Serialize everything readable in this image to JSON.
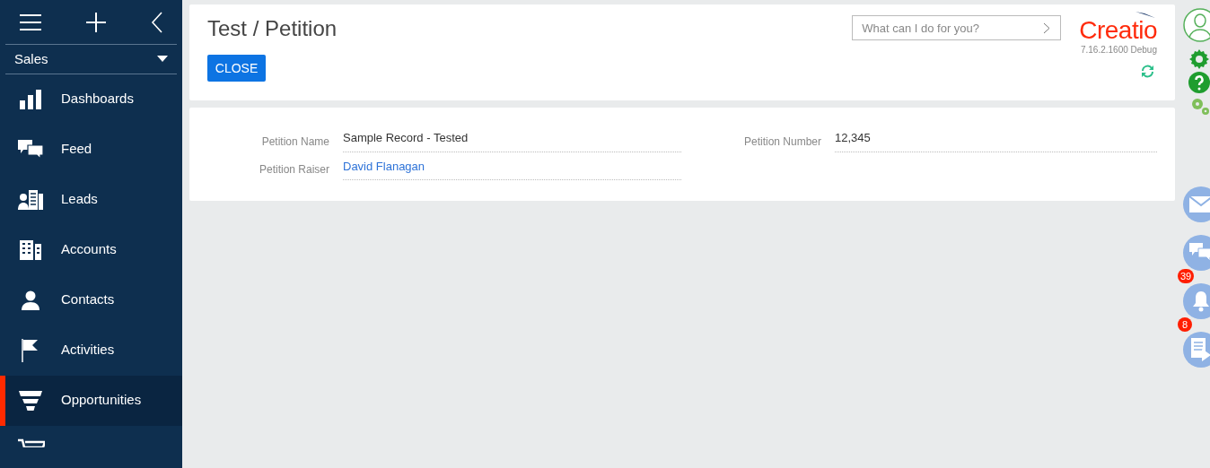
{
  "sidebar": {
    "workplace": "Sales",
    "items": [
      {
        "label": "Dashboards",
        "selected": false
      },
      {
        "label": "Feed",
        "selected": false
      },
      {
        "label": "Leads",
        "selected": false
      },
      {
        "label": "Accounts",
        "selected": false
      },
      {
        "label": "Contacts",
        "selected": false
      },
      {
        "label": "Activities",
        "selected": false
      },
      {
        "label": "Opportunities",
        "selected": true
      }
    ]
  },
  "header": {
    "title": "Test / Petition",
    "close_button": "CLOSE",
    "search": {
      "placeholder": "What can I do for you?"
    },
    "logo": "Creatio",
    "version": "7.16.2.1600 Debug"
  },
  "fields": [
    {
      "label": "Petition Name",
      "value": "Sample Record - Tested",
      "kind": "text"
    },
    {
      "label": "Petition Number",
      "value": "12,345",
      "kind": "text"
    },
    {
      "label": "Petition Raiser",
      "value": "David Flanagan",
      "kind": "link"
    }
  ],
  "right_rail": [
    {
      "kind": "mail"
    },
    {
      "kind": "chat"
    },
    {
      "kind": "bell",
      "badge": "39"
    },
    {
      "kind": "tasks",
      "badge": "8"
    }
  ]
}
